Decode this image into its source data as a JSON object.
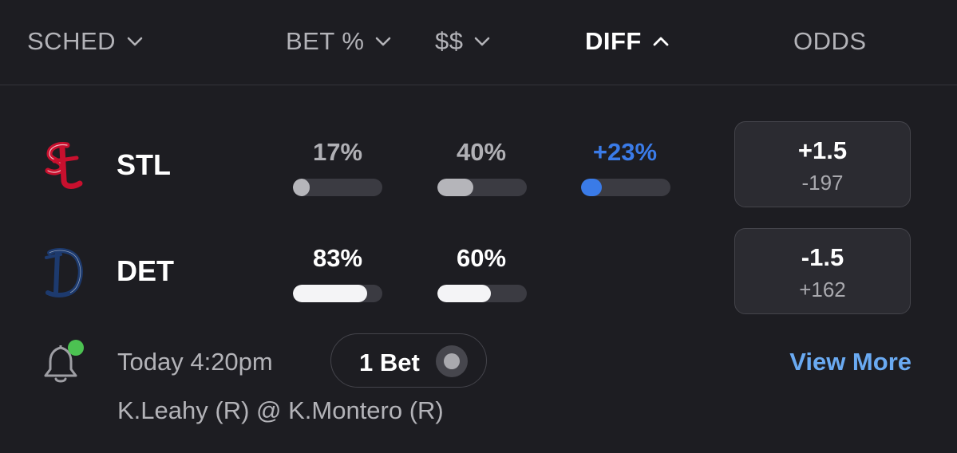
{
  "header": {
    "sched": "SCHED",
    "bet_pct": "BET %",
    "money": "$$",
    "diff": "DIFF",
    "odds": "ODDS"
  },
  "teams": [
    {
      "abbr": "STL",
      "logo": "cardinals-logo",
      "bet_pct": "17%",
      "bet_fraction": 0.17,
      "money_pct": "40%",
      "money_fraction": 0.4,
      "diff": "+23%",
      "diff_fraction": 0.23,
      "spread": "+1.5",
      "price": "-197"
    },
    {
      "abbr": "DET",
      "logo": "tigers-logo",
      "bet_pct": "83%",
      "bet_fraction": 0.83,
      "money_pct": "60%",
      "money_fraction": 0.6,
      "spread": "-1.5",
      "price": "+162"
    }
  ],
  "game": {
    "time": "Today 4:20pm",
    "bet_count": "1 Bet",
    "view_more": "View More",
    "pitchers": "K.Leahy (R) @ K.Montero (R)"
  },
  "colors": {
    "background": "#1d1d22",
    "accent_blue": "#3a7be8",
    "link_blue": "#6aaaf2",
    "notification_green": "#4cc252",
    "cardinals_red": "#c8102e",
    "tigers_navy": "#1d3a6e"
  },
  "icons": {
    "sort_collapsed": "chevron-down-icon",
    "sort_active": "chevron-up-icon",
    "alert": "bell-icon"
  }
}
